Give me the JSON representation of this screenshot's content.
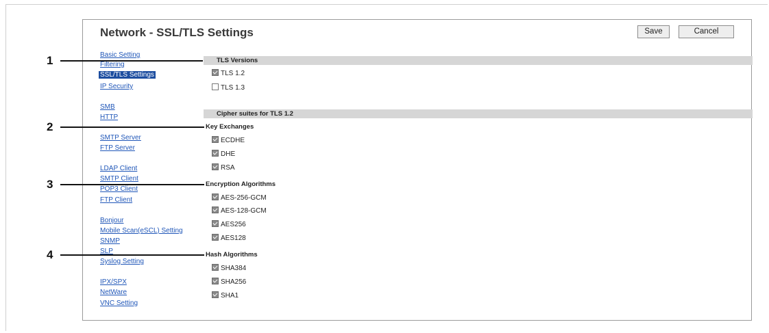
{
  "header": {
    "title": "Network - SSL/TLS Settings",
    "save_label": "Save",
    "cancel_label": "Cancel"
  },
  "callouts": [
    "1",
    "2",
    "3",
    "4"
  ],
  "nav": {
    "basic_setting": "Basic Setting",
    "filtering": "Filtering",
    "ssl_tls": "SSL/TLS Settings",
    "ip_security": "IP Security",
    "smb": "SMB",
    "http": "HTTP",
    "smtp_server": "SMTP Server",
    "ftp_server": "FTP Server",
    "ldap_client": "LDAP Client",
    "smtp_client": "SMTP Client",
    "pop3_client": "POP3 Client",
    "ftp_client": "FTP Client",
    "bonjour": "Bonjour",
    "mobile_scan": "Mobile Scan(eSCL) Setting",
    "snmp": "SNMP",
    "slp": "SLP",
    "syslog": "Syslog Setting",
    "ipx_spx": "IPX/SPX",
    "netware": "NetWare",
    "vnc": "VNC Setting"
  },
  "tls_versions": {
    "heading": "TLS Versions",
    "options": [
      {
        "label": "TLS 1.2",
        "checked": true
      },
      {
        "label": "TLS 1.3",
        "checked": false
      }
    ]
  },
  "cipher": {
    "heading": "Cipher suites for TLS 1.2",
    "key_exchanges": {
      "heading": "Key Exchanges",
      "options": [
        {
          "label": "ECDHE",
          "checked": true
        },
        {
          "label": "DHE",
          "checked": true
        },
        {
          "label": "RSA",
          "checked": true
        }
      ]
    },
    "encryption": {
      "heading": "Encryption Algorithms",
      "options": [
        {
          "label": "AES-256-GCM",
          "checked": true
        },
        {
          "label": "AES-128-GCM",
          "checked": true
        },
        {
          "label": "AES256",
          "checked": true
        },
        {
          "label": "AES128",
          "checked": true
        }
      ]
    },
    "hash": {
      "heading": "Hash Algorithms",
      "options": [
        {
          "label": "SHA384",
          "checked": true
        },
        {
          "label": "SHA256",
          "checked": true
        },
        {
          "label": "SHA1",
          "checked": true
        }
      ]
    }
  }
}
